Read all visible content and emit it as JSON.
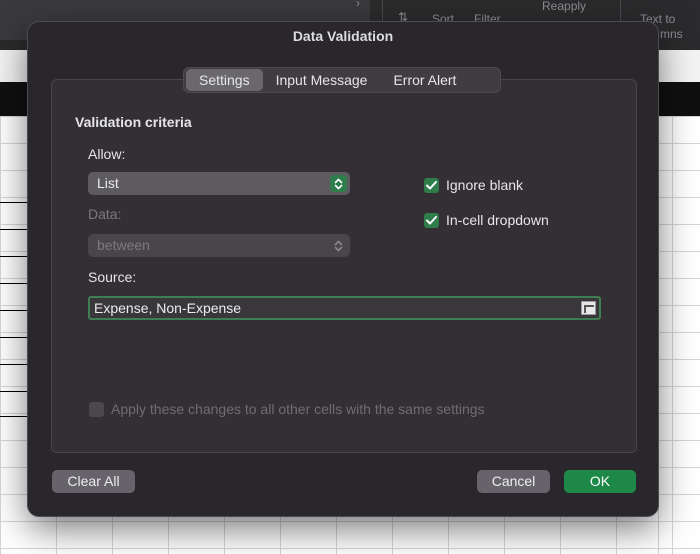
{
  "background": {
    "ribbon": {
      "reapply_label": "Reapply",
      "sort_label": "Sort",
      "filter_label": "Filter",
      "text_to_columns_line1": "Text to",
      "text_to_columns_line2": "mns"
    }
  },
  "dialog": {
    "title": "Data Validation",
    "tabs": [
      "Settings",
      "Input Message",
      "Error Alert"
    ],
    "active_tab": "Settings",
    "section_title": "Validation criteria",
    "allow": {
      "label": "Allow:",
      "value": "List"
    },
    "data": {
      "label": "Data:",
      "value": "between"
    },
    "source": {
      "label": "Source:",
      "value": "Expense, Non-Expense"
    },
    "ignore_blank": {
      "label": "Ignore blank",
      "checked": true
    },
    "in_cell_dropdown": {
      "label": "In-cell dropdown",
      "checked": true
    },
    "apply_all": {
      "label": "Apply these changes to all other cells with the same settings",
      "checked": false
    },
    "buttons": {
      "clear_all": "Clear All",
      "cancel": "Cancel",
      "ok": "OK"
    }
  },
  "colors": {
    "accent": "#1e8848",
    "dialog_bg": "#2a272c",
    "panel_bg": "#332f35",
    "source_border": "#3f7e52"
  }
}
